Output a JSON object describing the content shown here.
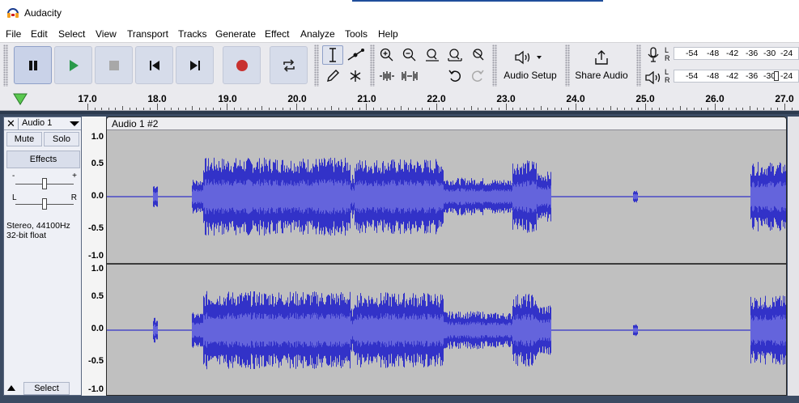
{
  "window": {
    "title": "Audacity"
  },
  "menu": [
    "File",
    "Edit",
    "Select",
    "View",
    "Transport",
    "Tracks",
    "Generate",
    "Effect",
    "Analyze",
    "Tools",
    "Help"
  ],
  "toolbar": {
    "audio_setup_label": "Audio Setup",
    "share_audio_label": "Share Audio",
    "meter_ticks": [
      "-54",
      "-48",
      "-42",
      "-36",
      "-30",
      "-24"
    ],
    "meter_lr": [
      "L",
      "R"
    ]
  },
  "ruler": {
    "labels": [
      "17.0",
      "18.0",
      "19.0",
      "20.0",
      "21.0",
      "22.0",
      "23.0",
      "24.0",
      "25.0",
      "26.0",
      "27.0"
    ]
  },
  "track": {
    "name": "Audio 1",
    "mute_label": "Mute",
    "solo_label": "Solo",
    "effects_label": "Effects",
    "gain_minus": "-",
    "gain_plus": "+",
    "pan_left": "L",
    "pan_right": "R",
    "format_line1": "Stereo, 44100Hz",
    "format_line2": "32-bit float",
    "select_label": "Select",
    "clip_name": "Audio 1 #2",
    "scale_labels": [
      "1.0",
      "0.5",
      "0.0",
      "-0.5",
      "-1.0"
    ]
  },
  "colors": {
    "waveform": "#3232c8",
    "waveform_rms": "#6464dc",
    "clip_bg": "#c0c0c0",
    "track_bg": "#3b4b63",
    "record": "#c8312f",
    "play": "#2a9a4a"
  }
}
